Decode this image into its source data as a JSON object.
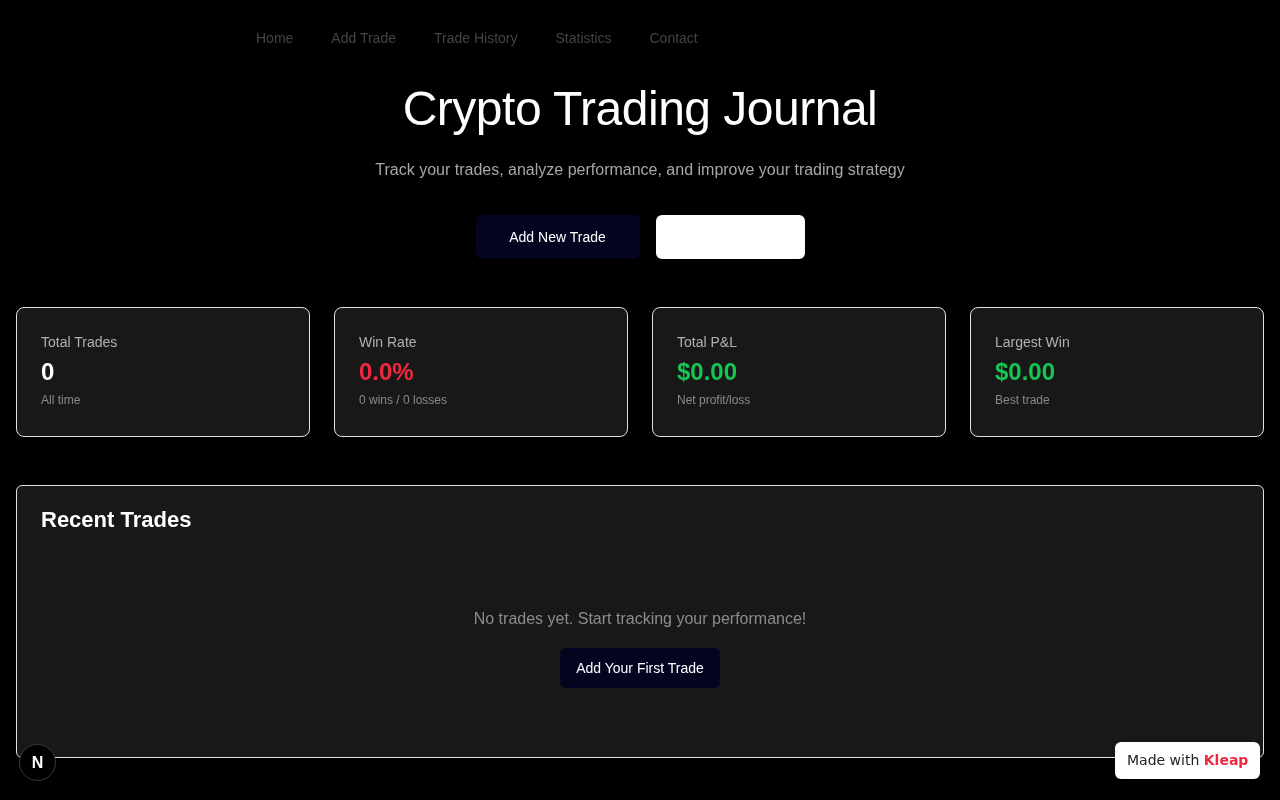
{
  "nav": {
    "links": [
      "Home",
      "Add Trade",
      "Trade History",
      "Statistics",
      "Contact"
    ]
  },
  "hero": {
    "title": "Crypto Trading Journal",
    "subtitle": "Track your trades, analyze performance, and improve your trading strategy",
    "buttons": [
      {
        "kind": "primary",
        "label": "Add New Trade"
      },
      {
        "kind": "blank"
      }
    ]
  },
  "stats": [
    {
      "label": "Total Trades",
      "value": "0",
      "note": "All time",
      "color": "#ffffff"
    },
    {
      "label": "Win Rate",
      "value": "0.0%",
      "note": "0 wins / 0 losses",
      "color": "#f0273f"
    },
    {
      "label": "Total P&L",
      "value": "$0.00",
      "note": "Net profit/loss",
      "color": "#16c653"
    },
    {
      "label": "Largest Win",
      "value": "$0.00",
      "note": "Best trade",
      "color": "#16c653"
    }
  ],
  "recent_trades": {
    "title": "Recent Trades",
    "empty_message": "No trades yet. Start tracking your performance!",
    "button": "Add Your First Trade"
  },
  "dev_indicator": {
    "letter": "N"
  },
  "badge": {
    "text": "Made with",
    "brand": "Kleap"
  }
}
